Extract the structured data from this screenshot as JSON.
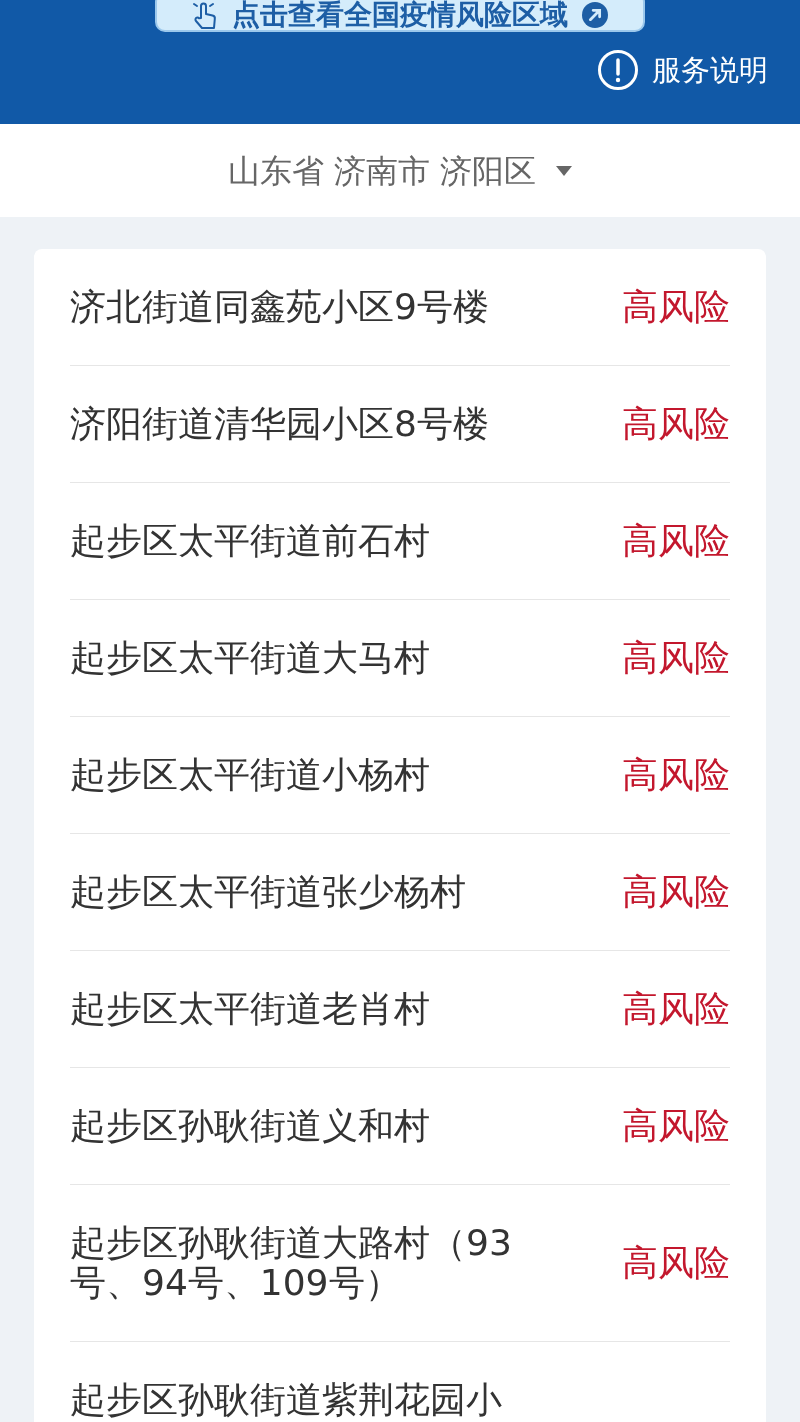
{
  "header": {
    "banner_link": {
      "label": "点击查看全国疫情风险区域"
    },
    "service_link": {
      "label": "服务说明"
    }
  },
  "location": {
    "label": "山东省 济南市 济阳区"
  },
  "areas": [
    {
      "name": "济北街道同鑫苑小区9号楼",
      "risk": "高风险"
    },
    {
      "name": "济阳街道清华园小区8号楼",
      "risk": "高风险"
    },
    {
      "name": "起步区太平街道前石村",
      "risk": "高风险"
    },
    {
      "name": "起步区太平街道大马村",
      "risk": "高风险"
    },
    {
      "name": "起步区太平街道小杨村",
      "risk": "高风险"
    },
    {
      "name": "起步区太平街道张少杨村",
      "risk": "高风险"
    },
    {
      "name": "起步区太平街道老肖村",
      "risk": "高风险"
    },
    {
      "name": "起步区孙耿街道义和村",
      "risk": "高风险"
    },
    {
      "name": "起步区孙耿街道大路村（93号、94号、109号）",
      "risk": "高风险"
    },
    {
      "name": "起步区孙耿街道紫荆花园小"
    }
  ]
}
